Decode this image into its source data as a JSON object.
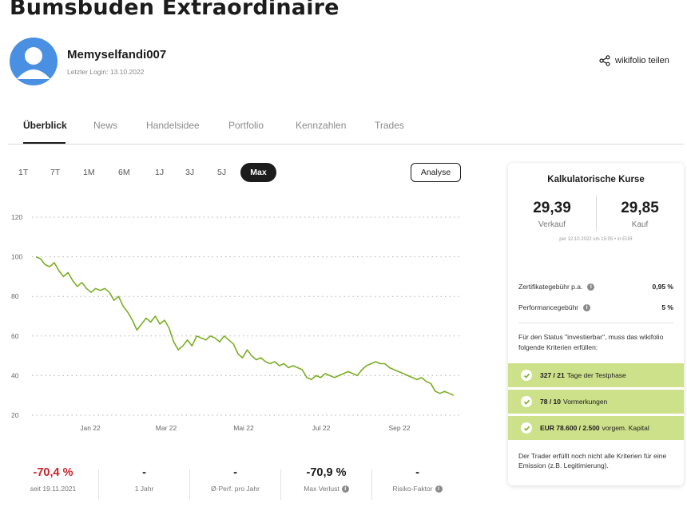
{
  "title": "Bumsbuden Extraordinaire",
  "user": {
    "name": "Memyselfandi007",
    "last_login": "Letzter Login: 13.10.2022"
  },
  "share": {
    "label": "wikifolio teilen",
    "icon": "share-icon"
  },
  "tabs": [
    {
      "label": "Überblick",
      "active": true
    },
    {
      "label": "News"
    },
    {
      "label": "Handelsidee"
    },
    {
      "label": "Portfolio"
    },
    {
      "label": "Kennzahlen"
    },
    {
      "label": "Trades"
    }
  ],
  "ranges": [
    "1T",
    "7T",
    "1M",
    "6M",
    "1J",
    "3J",
    "5J",
    "Max"
  ],
  "selected_range": "Max",
  "analyse_label": "Analyse",
  "chart_data": {
    "type": "line",
    "y_ticks": [
      "120",
      "100",
      "80",
      "60",
      "40",
      "20"
    ],
    "ylim": [
      20,
      120
    ],
    "x_ticks": [
      "Jan 22",
      "Mar 22",
      "Mai 22",
      "Jul 22",
      "Sep 22"
    ],
    "line_color": "#7cad24",
    "grid": "dotted horizontal",
    "series": [
      {
        "values": [
          100,
          99,
          96,
          95,
          97,
          93,
          90,
          92,
          88,
          85,
          87,
          84,
          82,
          84,
          83,
          84,
          82,
          78,
          80,
          75,
          72,
          68,
          63,
          66,
          69,
          67,
          70,
          66,
          68,
          64,
          57,
          53,
          55,
          58,
          55,
          60,
          59,
          58,
          60,
          59,
          57,
          60,
          58,
          56,
          51,
          49,
          53,
          50,
          48,
          49,
          47,
          46,
          47,
          45,
          46,
          44,
          45,
          44,
          43,
          39,
          38,
          40,
          39,
          41,
          40,
          39,
          40,
          41,
          42,
          41,
          40,
          43,
          45,
          46,
          47,
          46,
          46,
          44,
          43,
          42,
          41,
          40,
          39,
          38,
          39,
          37,
          36,
          32,
          31,
          32,
          31,
          30
        ]
      }
    ]
  },
  "stats": [
    {
      "value": "-70,4 %",
      "label": "seit 19.11.2021",
      "negative": true
    },
    {
      "value": "-",
      "label": "1 Jahr"
    },
    {
      "value": "-",
      "label": "Ø-Perf. pro Jahr"
    },
    {
      "value": "-70,9 %",
      "label": "Max Verlust",
      "info": true
    },
    {
      "value": "-",
      "label": "Risiko-Faktor",
      "info": true
    }
  ],
  "card": {
    "title": "Kalkulatorische Kurse",
    "sell": {
      "value": "29,39",
      "label": "Verkauf"
    },
    "buy": {
      "value": "29,85",
      "label": "Kauf"
    },
    "note": "per 12.10.2022 um 15:05 • in EUR",
    "fees": [
      {
        "label": "Zertifikategebühr p.a.",
        "value": "0,95 %"
      },
      {
        "label": "Performancegebühr",
        "value": "5 %"
      }
    ],
    "status_text": "Für den Status \"investierbar\", muss das wikifolio folgende Kriterien erfüllen:",
    "criteria": [
      {
        "bold": "327 / 21",
        "text": "Tage der Testphase"
      },
      {
        "bold": "78 / 10",
        "text": "Vormerkungen"
      },
      {
        "bold": "EUR 78.600 / 2.500",
        "text": "vorgem. Kapital"
      }
    ],
    "criteria_color": "#cde08a",
    "footer": "Der Trader erfüllt noch nicht alle Kriterien für eine Emission (z.B. Legitimierung)."
  }
}
